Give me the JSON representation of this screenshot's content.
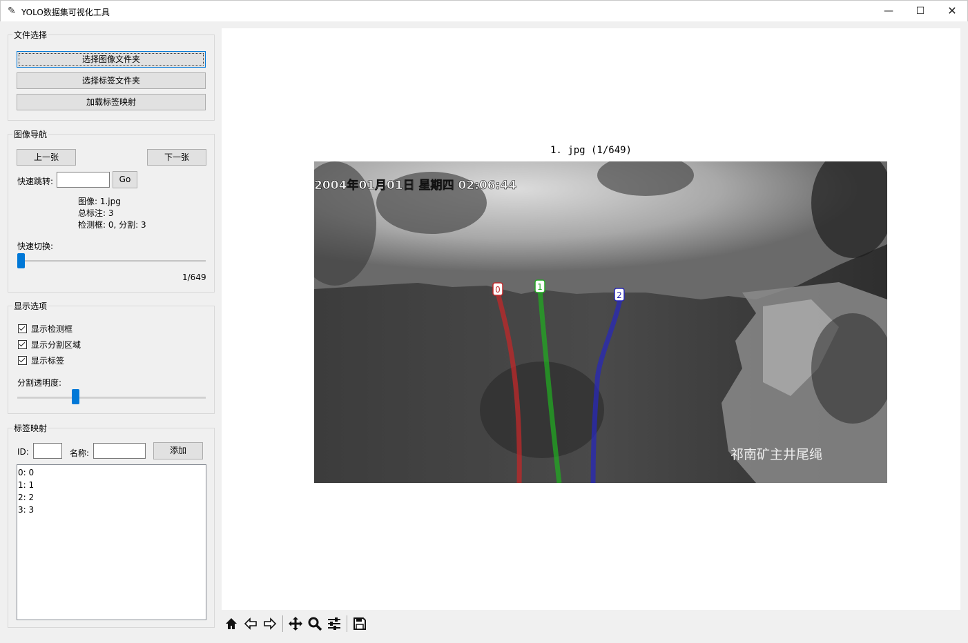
{
  "window": {
    "title": "YOLO数据集可视化工具",
    "controls": {
      "minimize": "—",
      "maximize": "☐",
      "close": "✕"
    }
  },
  "file_group": {
    "title": "文件选择",
    "buttons": [
      "选择图像文件夹",
      "选择标签文件夹",
      "加载标签映射"
    ]
  },
  "nav_group": {
    "title": "图像导航",
    "prev_label": "上一张",
    "next_label": "下一张",
    "jump_label": "快速跳转:",
    "jump_value": "",
    "go_label": "Go",
    "info": [
      "图像: 1.jpg",
      "总标注: 3",
      "检测框: 0, 分割: 3"
    ],
    "switch_label": "快速切换:",
    "slider_position": 0.0,
    "counter": "1/649"
  },
  "display_group": {
    "title": "显示选项",
    "checks": [
      {
        "label": "显示检测框",
        "checked": true
      },
      {
        "label": "显示分割区域",
        "checked": true
      },
      {
        "label": "显示标签",
        "checked": true
      }
    ],
    "alpha_label": "分割透明度:",
    "alpha_value": 0.3
  },
  "label_group": {
    "title": "标签映射",
    "id_label": "ID:",
    "id_value": "",
    "name_label": "名称:",
    "name_value": "",
    "add_label": "添加",
    "mappings": [
      "0: 0",
      "1: 1",
      "2: 2",
      "3: 3"
    ]
  },
  "plot": {
    "title": "1. jpg (1/649)",
    "timestamp": "2004年01月01日  星期四  02:06:44",
    "caption": "祁南矿主井尾绳",
    "annotations": [
      {
        "label": "0",
        "color": "#c0282a"
      },
      {
        "label": "1",
        "color": "#22a822"
      },
      {
        "label": "2",
        "color": "#2828b8"
      }
    ]
  },
  "toolbar": {
    "icons": [
      "home-icon",
      "back-arrow-icon",
      "forward-arrow-icon",
      "pan-icon",
      "zoom-icon",
      "configure-subplots-icon",
      "save-icon"
    ]
  }
}
